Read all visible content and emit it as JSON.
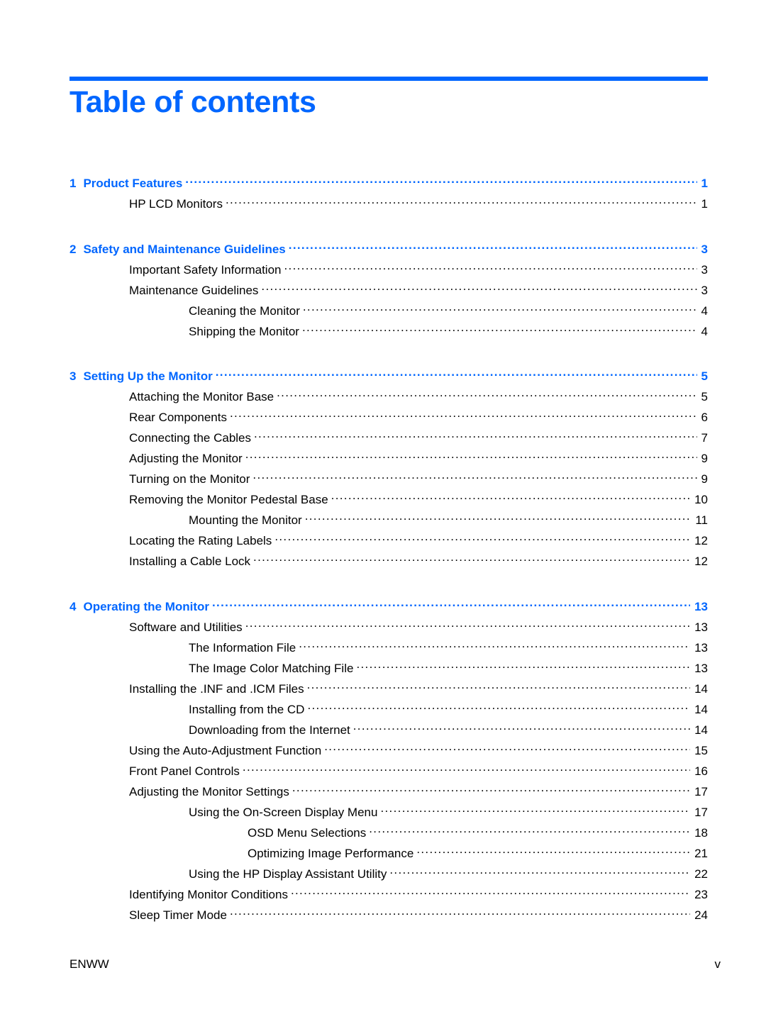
{
  "page": {
    "title": "Table of contents",
    "accent_color": "#0066ff",
    "footer_left": "ENWW",
    "footer_right": "v"
  },
  "toc": [
    {
      "level": 0,
      "num": "1",
      "label": "Product Features",
      "page": "1"
    },
    {
      "level": 1,
      "label": "HP LCD Monitors",
      "page": "1"
    },
    {
      "level": 0,
      "num": "2",
      "label": "Safety and Maintenance Guidelines",
      "page": "3"
    },
    {
      "level": 1,
      "label": "Important Safety Information",
      "page": "3"
    },
    {
      "level": 1,
      "label": "Maintenance Guidelines",
      "page": "3"
    },
    {
      "level": 2,
      "label": "Cleaning the Monitor",
      "page": "4"
    },
    {
      "level": 2,
      "label": "Shipping the Monitor",
      "page": "4"
    },
    {
      "level": 0,
      "num": "3",
      "label": "Setting Up the Monitor",
      "page": "5"
    },
    {
      "level": 1,
      "label": "Attaching the Monitor Base",
      "page": "5"
    },
    {
      "level": 1,
      "label": "Rear Components",
      "page": "6"
    },
    {
      "level": 1,
      "label": "Connecting the Cables",
      "page": "7"
    },
    {
      "level": 1,
      "label": "Adjusting the Monitor",
      "page": "9"
    },
    {
      "level": 1,
      "label": "Turning on the Monitor",
      "page": "9"
    },
    {
      "level": 1,
      "label": "Removing the Monitor Pedestal Base",
      "page": "10"
    },
    {
      "level": 2,
      "label": "Mounting the Monitor",
      "page": "11"
    },
    {
      "level": 1,
      "label": "Locating the Rating Labels",
      "page": "12"
    },
    {
      "level": 1,
      "label": "Installing a Cable Lock",
      "page": "12"
    },
    {
      "level": 0,
      "num": "4",
      "label": "Operating the Monitor",
      "page": "13"
    },
    {
      "level": 1,
      "label": "Software and Utilities",
      "page": "13"
    },
    {
      "level": 2,
      "label": "The Information File",
      "page": "13"
    },
    {
      "level": 2,
      "label": "The Image Color Matching File",
      "page": "13"
    },
    {
      "level": 1,
      "label": "Installing the .INF and .ICM Files",
      "page": "14"
    },
    {
      "level": 2,
      "label": "Installing from the CD",
      "page": "14"
    },
    {
      "level": 2,
      "label": "Downloading from the Internet",
      "page": "14"
    },
    {
      "level": 1,
      "label": "Using the Auto-Adjustment Function",
      "page": "15"
    },
    {
      "level": 1,
      "label": "Front Panel Controls",
      "page": "16"
    },
    {
      "level": 1,
      "label": "Adjusting the Monitor Settings",
      "page": "17"
    },
    {
      "level": 2,
      "label": "Using the On-Screen Display Menu",
      "page": "17"
    },
    {
      "level": 3,
      "label": "OSD Menu Selections",
      "page": "18"
    },
    {
      "level": 3,
      "label": "Optimizing Image Performance",
      "page": "21"
    },
    {
      "level": 2,
      "label": "Using the HP Display Assistant Utility",
      "page": "22"
    },
    {
      "level": 1,
      "label": "Identifying Monitor Conditions",
      "page": "23"
    },
    {
      "level": 1,
      "label": "Sleep Timer Mode",
      "page": "24"
    }
  ]
}
